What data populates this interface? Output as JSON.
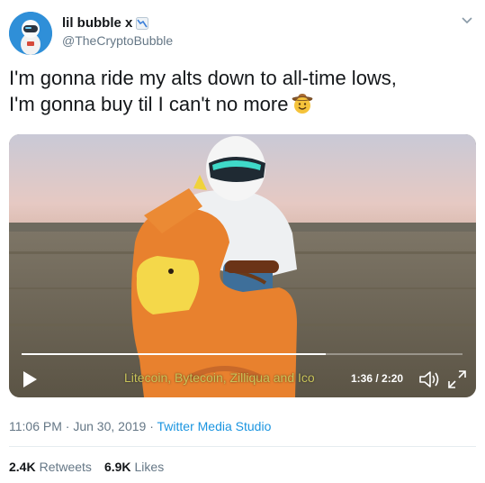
{
  "user": {
    "display_name": "lil bubble x",
    "handle": "@TheCryptoBubble",
    "avatar_icon": "astronaut-icon",
    "name_emoji": "chart-decreasing-icon"
  },
  "tweet": {
    "lines": [
      "I'm gonna ride my alts down to all-time lows,",
      "I'm gonna buy til I can't no more"
    ],
    "emoji": "cowboy-hat-face-icon"
  },
  "video": {
    "subtitle": "Litecoin, Bytecoin, Zilliqua and Ico",
    "time": "1:36 / 2:20",
    "progress": 0.69,
    "controls": [
      "play-icon",
      "volume-icon",
      "fullscreen-icon"
    ]
  },
  "meta": {
    "time": "11:06 PM",
    "date": "Jun 30, 2019",
    "separator": "·",
    "source": "Twitter Media Studio"
  },
  "stats": {
    "retweets_count": "2.4K",
    "retweets_label": "Retweets",
    "likes_count": "6.9K",
    "likes_label": "Likes"
  },
  "colors": {
    "link": "#1b95e0",
    "secondary": "#657786",
    "primary_text": "#14171a",
    "subtitle": "#c9c35a"
  }
}
